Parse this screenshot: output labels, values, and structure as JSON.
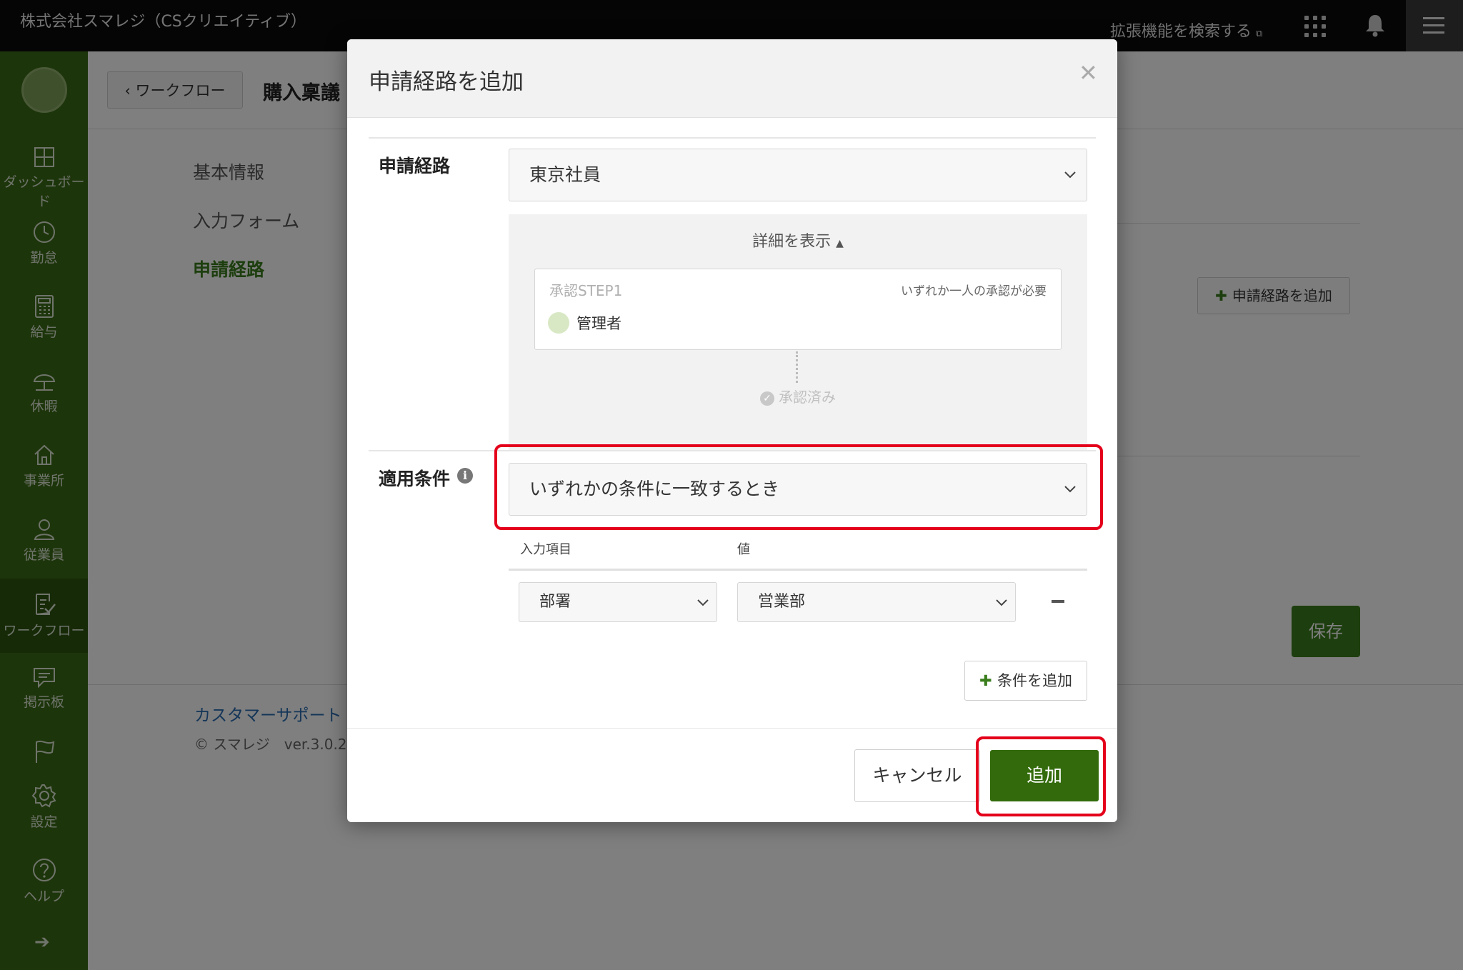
{
  "topbar": {
    "company": "株式会社スマレジ（CSクリエイティブ）",
    "ext_search": "拡張機能を検索する"
  },
  "sidebar": {
    "items": [
      {
        "label": "ダッシュボード",
        "icon": "dashboard-icon"
      },
      {
        "label": "勤怠",
        "icon": "clock-icon"
      },
      {
        "label": "給与",
        "icon": "calculator-icon"
      },
      {
        "label": "休暇",
        "icon": "umbrella-icon"
      },
      {
        "label": "事業所",
        "icon": "home-icon"
      },
      {
        "label": "従業員",
        "icon": "person-icon"
      },
      {
        "label": "ワークフロー",
        "icon": "checklist-icon",
        "active": true
      },
      {
        "label": "掲示板",
        "icon": "message-icon"
      },
      {
        "label": "",
        "icon": "flag-icon"
      },
      {
        "label": "設定",
        "icon": "gear-icon"
      },
      {
        "label": "ヘルプ",
        "icon": "help-icon"
      }
    ]
  },
  "page": {
    "back_label": "ワークフロー",
    "title": "購入稟議",
    "nav": [
      "基本情報",
      "入力フォーム",
      "申請経路"
    ],
    "add_route_label": "申請経路を追加",
    "save_label": "保存",
    "support_link": "カスタマーサポート",
    "copyright": "© スマレジ　ver.3.0.2"
  },
  "modal": {
    "title": "申請経路を追加",
    "route_label": "申請経路",
    "route_value": "東京社員",
    "detail_toggle": "詳細を表示",
    "step": {
      "name": "承認STEP1",
      "rule": "いずれか一人の承認が必要",
      "approver": "管理者"
    },
    "approved_label": "承認済み",
    "condition_label": "適用条件",
    "match_value": "いずれかの条件に一致するとき",
    "columns": {
      "field": "入力項目",
      "value": "値"
    },
    "condition_row": {
      "field": "部署",
      "value": "営業部"
    },
    "add_condition_label": "条件を追加",
    "cancel_label": "キャンセル",
    "add_label": "追加"
  },
  "colors": {
    "brand_green": "#3a6a16",
    "primary_button": "#336b0c",
    "highlight": "#e4001b"
  }
}
